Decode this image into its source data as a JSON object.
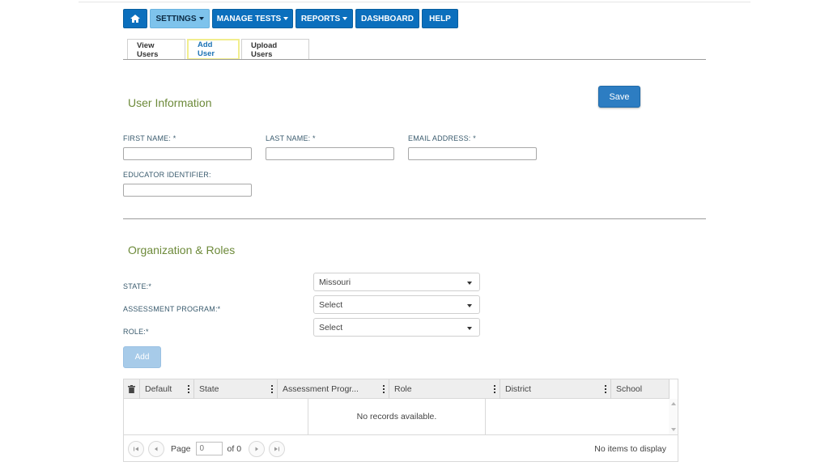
{
  "nav": {
    "items": [
      {
        "label": "SETTINGS",
        "dropdown": true,
        "active": true
      },
      {
        "label": "MANAGE TESTS",
        "dropdown": true
      },
      {
        "label": "REPORTS",
        "dropdown": true
      },
      {
        "label": "DASHBOARD"
      },
      {
        "label": "HELP"
      }
    ]
  },
  "tabs": [
    "View Users",
    "Add User",
    "Upload Users"
  ],
  "user_info": {
    "title": "User Information",
    "save_label": "Save",
    "first_name_label": "FIRST NAME: *",
    "last_name_label": "LAST NAME: *",
    "email_label": "EMAIL ADDRESS: *",
    "educator_label": "EDUCATOR IDENTIFIER:",
    "first_name_value": "",
    "last_name_value": "",
    "email_value": "",
    "educator_value": ""
  },
  "org": {
    "title": "Organization & Roles",
    "state_label": "STATE:*",
    "state_value": "Missouri",
    "program_label": "ASSESSMENT PROGRAM:*",
    "program_value": "Select",
    "role_label": "ROLE:*",
    "role_value": "Select",
    "add_label": "Add"
  },
  "grid": {
    "columns": [
      "Default",
      "State",
      "Assessment Progr...",
      "Role",
      "District",
      "School"
    ],
    "empty_text": "No records available.",
    "pager": {
      "page_label": "Page",
      "page_value": "0",
      "of_label": "of 0",
      "items_text": "No items to display"
    }
  },
  "colors": {
    "nav_bg": "#0b6fbd",
    "nav_active": "#7ec3ec",
    "section_title": "#6d8a3a",
    "save_button": "#2d7dc2"
  }
}
